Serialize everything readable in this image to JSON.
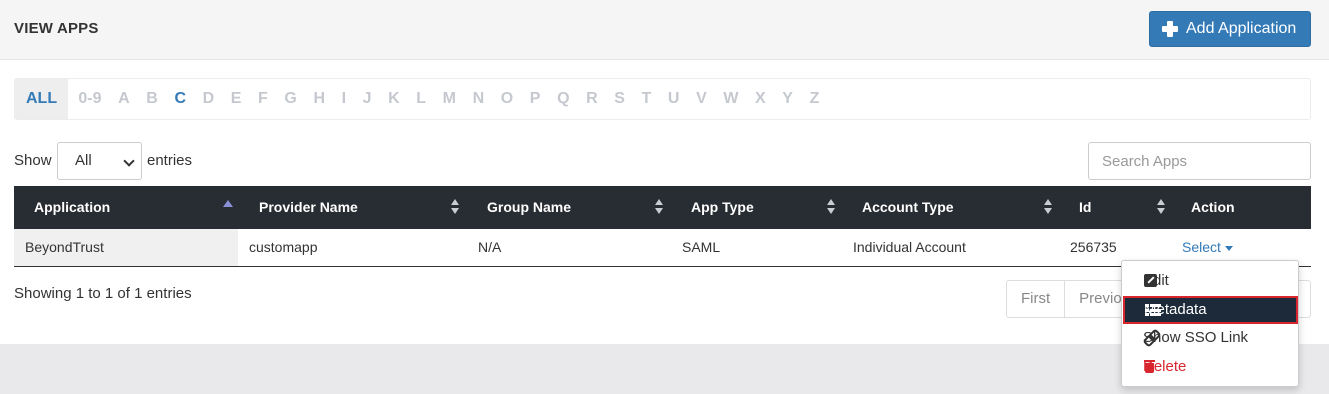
{
  "header": {
    "title": "VIEW APPS",
    "add_button_label": "Add Application"
  },
  "alphabet": [
    "ALL",
    "0-9",
    "A",
    "B",
    "C",
    "D",
    "E",
    "F",
    "G",
    "H",
    "I",
    "J",
    "K",
    "L",
    "M",
    "N",
    "O",
    "P",
    "Q",
    "R",
    "S",
    "T",
    "U",
    "V",
    "W",
    "X",
    "Y",
    "Z"
  ],
  "alphabet_active": [
    "ALL",
    "C"
  ],
  "controls": {
    "show_label": "Show",
    "show_value": "All",
    "entries_label": "entries",
    "search_placeholder": "Search Apps"
  },
  "table": {
    "columns": [
      "Application",
      "Provider Name",
      "Group Name",
      "App Type",
      "Account Type",
      "Id",
      "Action"
    ],
    "rows": [
      {
        "application": "BeyondTrust",
        "provider": "customapp",
        "group": "N/A",
        "app_type": "SAML",
        "account_type": "Individual Account",
        "id": "256735",
        "action": "Select"
      }
    ]
  },
  "footer": {
    "showing_text": "Showing 1 to 1 of 1 entries",
    "pager": [
      "First",
      "Previous"
    ]
  },
  "dropdown": {
    "items": [
      {
        "label": "Edit",
        "icon": "edit-icon"
      },
      {
        "label": "Metadata",
        "icon": "list-icon"
      },
      {
        "label": "Show SSO Link",
        "icon": "link-icon"
      },
      {
        "label": "Delete",
        "icon": "trash-icon"
      }
    ]
  },
  "colors": {
    "primary": "#337ab7",
    "header_dark": "#282d33",
    "danger": "#d9262e",
    "highlight": "#1c2a3a"
  }
}
